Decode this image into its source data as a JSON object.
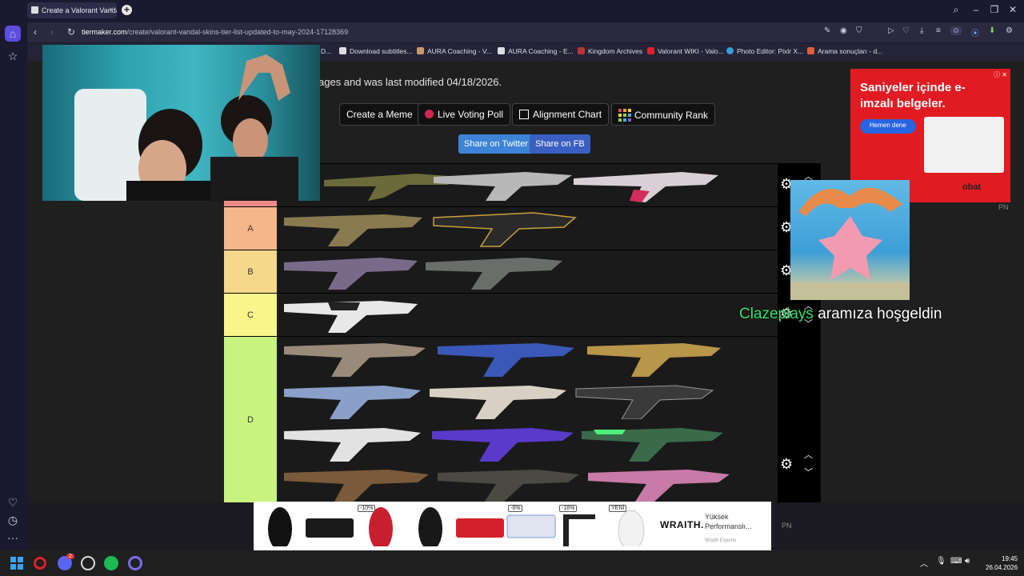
{
  "browser": {
    "tab_title": "Create a Valorant Vandal",
    "url_host": "tiermaker.com",
    "url_path": "/create/valorant-vandal-skins-tier-list-updated-to-may-2024-17128369"
  },
  "bookmarks": [
    "D...",
    "Download subtitles...",
    "AURA Coaching - V...",
    "AURA Coaching - E...",
    "Kingdom Archives",
    "Valorant WIKI - Valo...",
    "Photo Editor: Pixlr X...",
    "Arama sonuçları - d..."
  ],
  "page": {
    "modified_text": "ages and was last modified 04/18/2026.",
    "buttons": {
      "meme": "Create a Meme",
      "poll": "Live Voting Poll",
      "alignment": "Alignment Chart",
      "community": "Community Rank"
    },
    "share": {
      "twitter": "Share on Twitter",
      "fb": "Share on FB"
    }
  },
  "tiers": [
    {
      "label": "A",
      "color": "#f5b68a"
    },
    {
      "label": "B",
      "color": "#f6d88a"
    },
    {
      "label": "C",
      "color": "#f8f58b"
    },
    {
      "label": "D",
      "color": "#c9f37f"
    }
  ],
  "ads": {
    "right_headline": "Saniyeler içinde e-imzalı belgeler.",
    "right_button": "Hemen dene",
    "right_brand": "obat",
    "pn": "PN",
    "bottom_badges": [
      "-10%",
      "-6%",
      "-16%",
      "YENİ"
    ],
    "bottom_brand": "WRAITH.",
    "bottom_text": "Yüksek Performanslı...",
    "bottom_sub": "Wraith Esports"
  },
  "overlay": {
    "welcome_user": "Clazeplays",
    "welcome_text": "aramıza hoşgeldin"
  },
  "taskbar": {
    "time": "19:45",
    "date": "26.04.2026",
    "discord_badge": "2"
  }
}
